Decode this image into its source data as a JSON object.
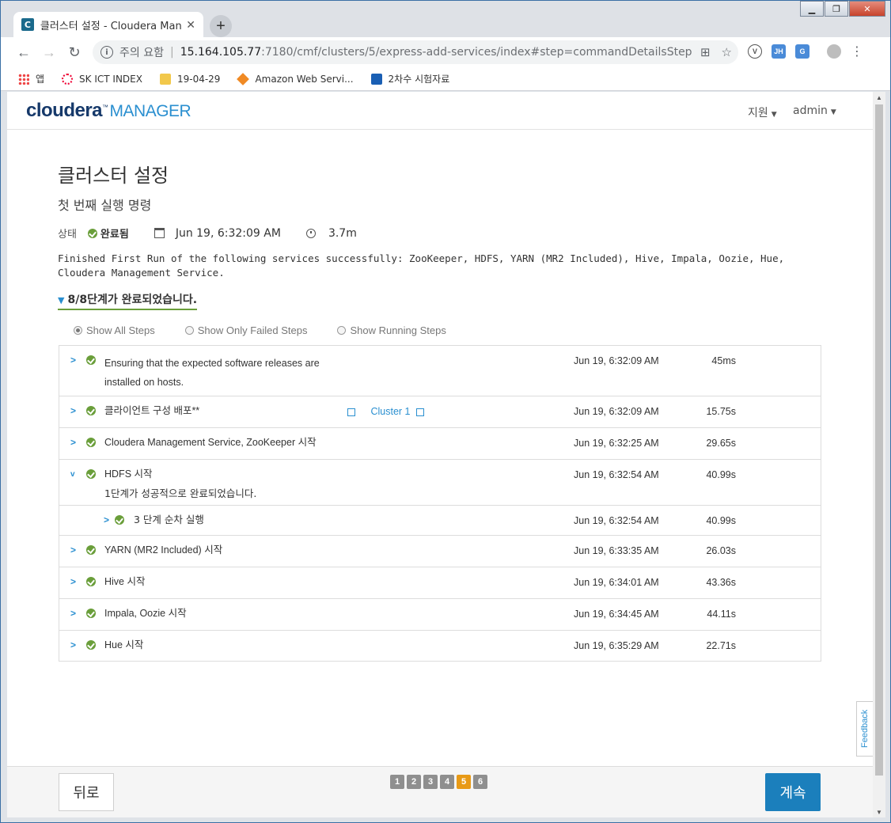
{
  "browser": {
    "tab_title": "클러스터 설정 - Cloudera Mana",
    "tab_favicon": "C",
    "url_warning": "주의 요함",
    "url_host": "15.164.105.77",
    "url_path": ":7180/cmf/clusters/5/express-add-services/index#step=commandDetailsStep",
    "bookmarks": [
      {
        "label": "앱"
      },
      {
        "label": "SK ICT INDEX"
      },
      {
        "label": "19-04-29"
      },
      {
        "label": "Amazon Web Servi..."
      },
      {
        "label": "2차수 시험자료"
      }
    ],
    "ext_jh": "JH"
  },
  "header": {
    "logo_main": "cloudera",
    "logo_manager": "MANAGER",
    "support_menu": "지원",
    "user_menu": "admin"
  },
  "page": {
    "title": "클러스터 설정",
    "subtitle": "첫 번째 실행 명령",
    "status_label": "상태",
    "status_value": "완료됨",
    "start_time": "Jun 19, 6:32:09 AM",
    "duration": "3.7m",
    "message": "Finished First Run of the following services successfully: ZooKeeper, HDFS, YARN (MR2 Included), Hive, Impala, Oozie, Hue, Cloudera Management Service.",
    "steps_summary": "8/8단계가 완료되었습니다."
  },
  "filters": {
    "all": "Show All Steps",
    "failed": "Show Only Failed Steps",
    "running": "Show Running Steps"
  },
  "steps": [
    {
      "name": "Ensuring that the expected software releases are installed on hosts.",
      "time": "Jun 19, 6:32:09 AM",
      "duration": "45ms"
    },
    {
      "name": "클라이언트 구성 배포**",
      "link": "Cluster 1",
      "time": "Jun 19, 6:32:09 AM",
      "duration": "15.75s"
    },
    {
      "name": "Cloudera Management Service, ZooKeeper 시작",
      "time": "Jun 19, 6:32:25 AM",
      "duration": "29.65s"
    },
    {
      "name": "HDFS 시작",
      "sub": "1단계가 성공적으로 완료되었습니다.",
      "time": "Jun 19, 6:32:54 AM",
      "duration": "40.99s"
    },
    {
      "name": "3 단계 순차 실행",
      "time": "Jun 19, 6:32:54 AM",
      "duration": "40.99s"
    },
    {
      "name": "YARN (MR2 Included) 시작",
      "time": "Jun 19, 6:33:35 AM",
      "duration": "26.03s"
    },
    {
      "name": "Hive 시작",
      "time": "Jun 19, 6:34:01 AM",
      "duration": "43.36s"
    },
    {
      "name": "Impala, Oozie 시작",
      "time": "Jun 19, 6:34:45 AM",
      "duration": "44.11s"
    },
    {
      "name": "Hue 시작",
      "time": "Jun 19, 6:35:29 AM",
      "duration": "22.71s"
    }
  ],
  "footer": {
    "back": "뒤로",
    "next": "계속",
    "pages": [
      "1",
      "2",
      "3",
      "4",
      "5",
      "6"
    ],
    "feedback": "Feedback"
  },
  "colors": {
    "accent": "#2a8fd0",
    "success": "#6a9e3a",
    "primary_button": "#1b7fbc",
    "active_page": "#e89a16"
  }
}
